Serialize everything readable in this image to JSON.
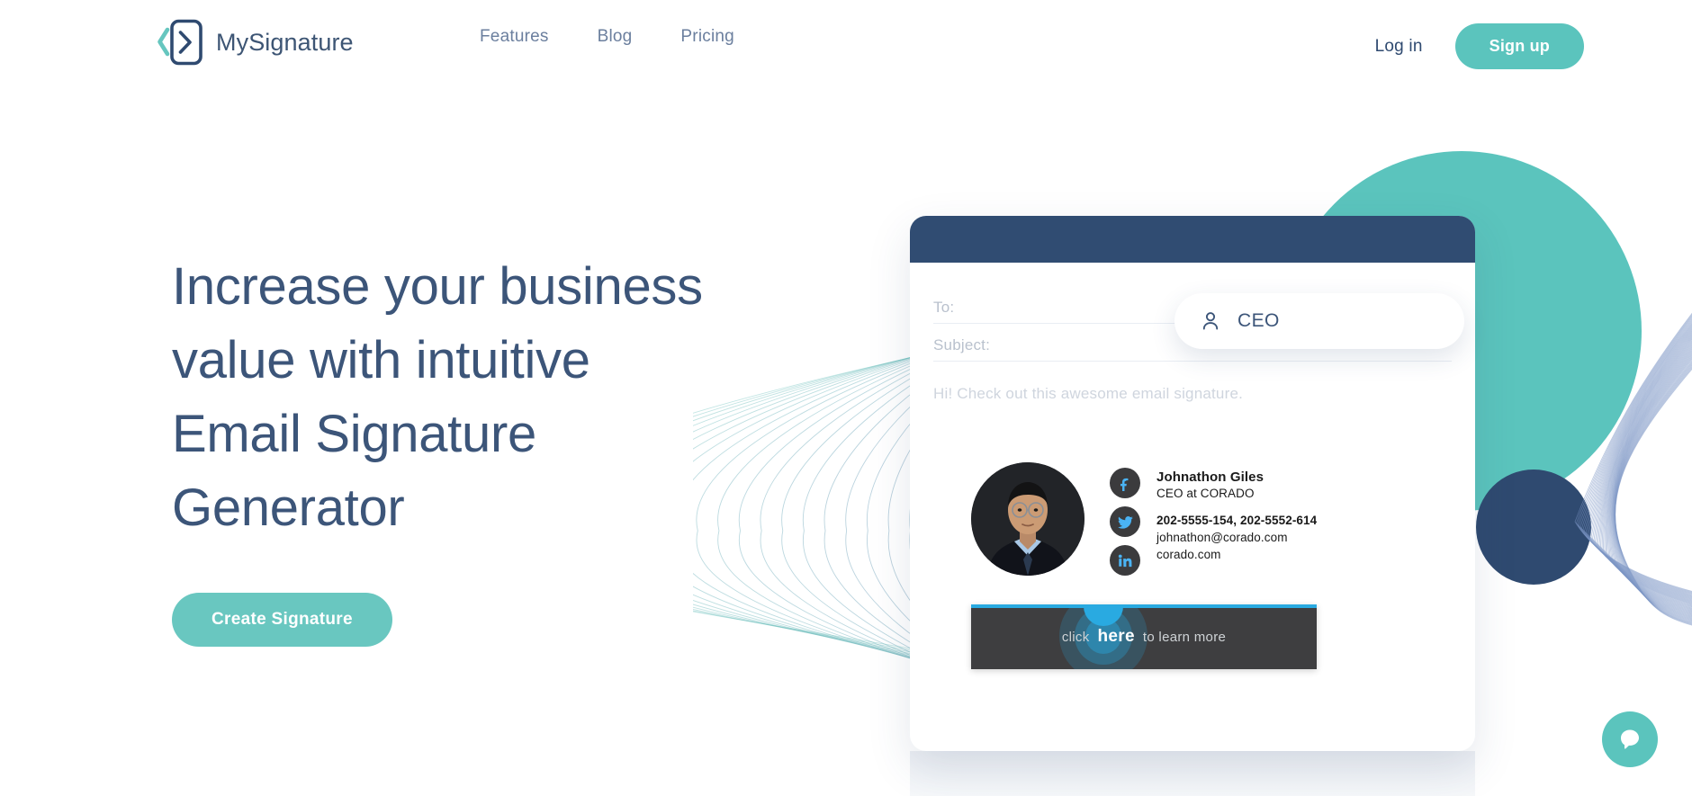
{
  "header": {
    "brand": {
      "name": "MySignature",
      "logo_icon": "chevron-logo-icon"
    },
    "nav": [
      {
        "label": "Features"
      },
      {
        "label": "Blog"
      },
      {
        "label": "Pricing"
      }
    ],
    "login_label": "Log in",
    "signup_label": "Sign up"
  },
  "hero": {
    "headline_line1": "Increase your business",
    "headline_line2": "value with intuitive",
    "headline_line3": "Email Signature",
    "headline_line4": "Generator",
    "cta_label": "Create Signature"
  },
  "email_mock": {
    "to_label": "To:",
    "subject_label": "Subject:",
    "greeting": "Hi! Check out this awesome email signature.",
    "suggestion": {
      "icon": "person-icon",
      "label": "CEO"
    },
    "signature": {
      "name": "Johnathon Giles",
      "role": "CEO at CORADO",
      "phone": "202-5555-154, 202-5552-614",
      "email": "johnathon@corado.com",
      "website": "corado.com",
      "socials": [
        {
          "name": "facebook-icon"
        },
        {
          "name": "twitter-icon"
        },
        {
          "name": "linkedin-icon"
        }
      ]
    },
    "banner": {
      "prefix": "click",
      "highlight": "here",
      "suffix": "to learn more"
    }
  },
  "chat": {
    "icon": "chat-bubble-icon"
  },
  "colors": {
    "teal": "#5bc4bd",
    "navy": "#304c72",
    "headline": "#3c5579",
    "nav_link": "#6b7f9e",
    "banner_bg": "#3e3e40",
    "banner_accent": "#29aae1",
    "social_bg": "#3b3b3d",
    "social_glyph": "#4ab3f4"
  }
}
